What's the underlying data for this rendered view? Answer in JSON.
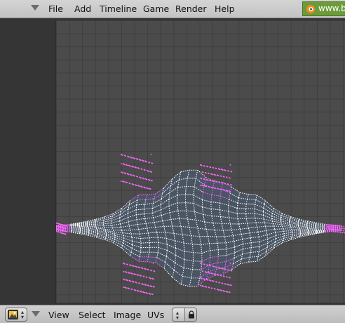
{
  "top_menu": {
    "items": [
      "File",
      "Add",
      "Timeline",
      "Game",
      "Render",
      "Help"
    ],
    "site_link": "www.b"
  },
  "bottom_menu": {
    "items": [
      "View",
      "Select",
      "Image",
      "UVs"
    ]
  },
  "colors": {
    "uv_edge": "#ffffff",
    "uv_selected": "#ff66ff",
    "face_fill": "#4a5564"
  },
  "icons": {
    "editor_type": "uv-image-editor-icon",
    "menu_collapse": "triangle-down-icon",
    "sync": "lock-icon"
  }
}
